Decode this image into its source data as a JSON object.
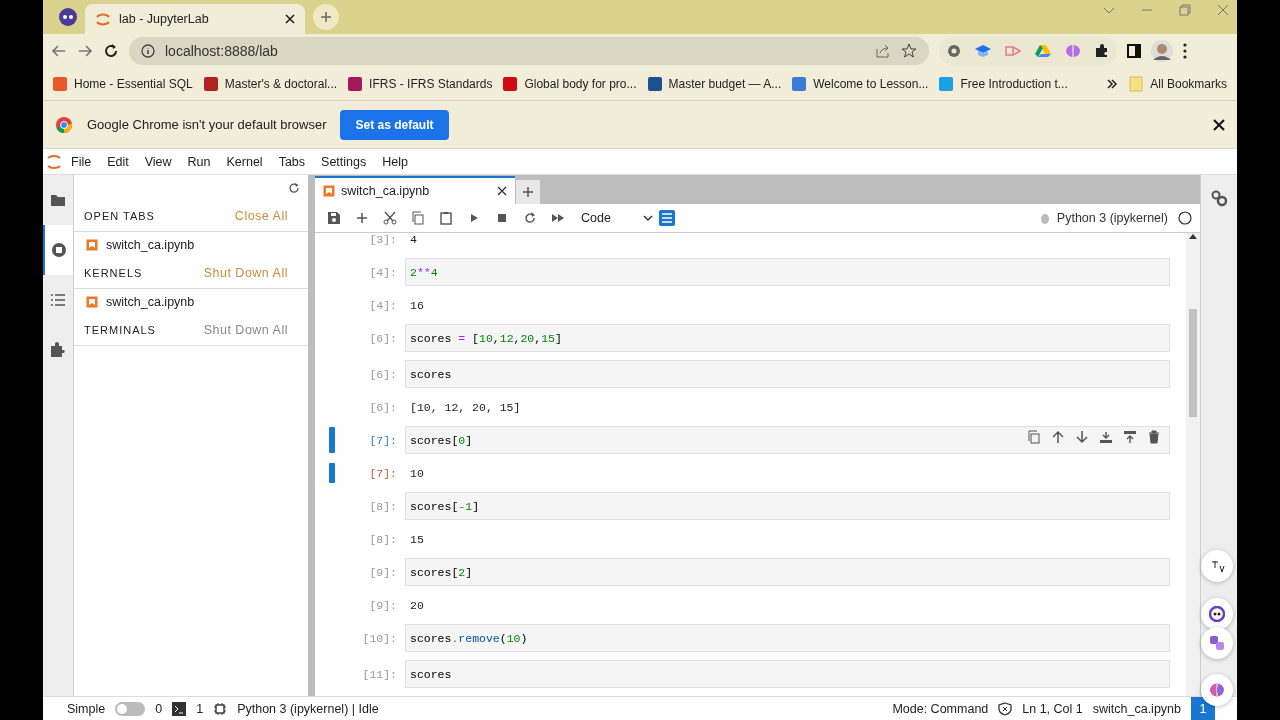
{
  "browser": {
    "tabs": [
      {
        "title": "lab - JupyterLab",
        "selected": true
      }
    ],
    "url": "localhost:8888/lab",
    "bookmarks": [
      {
        "title": "Home - Essential SQL",
        "color": "#e8582a"
      },
      {
        "title": "Master's & doctoral...",
        "color": "#b22222"
      },
      {
        "title": "IFRS - IFRS Standards",
        "color": "#a3195b"
      },
      {
        "title": "Global body for pro...",
        "color": "#d10a11"
      },
      {
        "title": "Master budget — A...",
        "color": "#1d4f91"
      },
      {
        "title": "Welcome to Lesson...",
        "color": "#3a7bd5"
      },
      {
        "title": "Free Introduction t...",
        "color": "#1ba1e2"
      }
    ],
    "all_bookmarks": "All Bookmarks"
  },
  "infobar": {
    "message": "Google Chrome isn't your default browser",
    "button": "Set as default"
  },
  "menu": [
    "File",
    "Edit",
    "View",
    "Run",
    "Kernel",
    "Tabs",
    "Settings",
    "Help"
  ],
  "sidebar": {
    "tabs": [
      {
        "kind": "folder",
        "selected": false
      },
      {
        "kind": "running",
        "selected": true
      },
      {
        "kind": "toc",
        "selected": false
      },
      {
        "kind": "extension",
        "selected": false
      }
    ],
    "sections": [
      {
        "title": "OPEN TABS",
        "action": "Close All",
        "enabled": true,
        "items": [
          "switch_ca.ipynb"
        ]
      },
      {
        "title": "KERNELS",
        "action": "Shut Down All",
        "enabled": true,
        "items": [
          "switch_ca.ipynb"
        ]
      },
      {
        "title": "TERMINALS",
        "action": "Shut Down All",
        "enabled": false
      }
    ]
  },
  "notebook": {
    "tab": {
      "title": "switch_ca.ipynb",
      "selected": true
    },
    "cell_type": "Code",
    "kernel": "Python 3 (ipykernel)",
    "cells": [
      {
        "kind": "output",
        "prompt": "[3]:",
        "text": "4",
        "selected": false
      },
      {
        "kind": "input",
        "prompt": "[4]:",
        "selected": false,
        "code": [
          {
            "kind": "num",
            "text": "2"
          },
          {
            "kind": "op",
            "text": "**"
          },
          {
            "kind": "num",
            "text": "4"
          }
        ]
      },
      {
        "kind": "output",
        "prompt": "[4]:",
        "text": "16",
        "selected": false
      },
      {
        "kind": "input",
        "prompt": "[6]:",
        "selected": false,
        "code": [
          {
            "kind": "name",
            "text": "scores "
          },
          {
            "kind": "op",
            "text": "="
          },
          {
            "kind": "name",
            "text": " ["
          },
          {
            "kind": "num",
            "text": "10"
          },
          {
            "kind": "name",
            "text": ","
          },
          {
            "kind": "num",
            "text": "12"
          },
          {
            "kind": "name",
            "text": ","
          },
          {
            "kind": "num",
            "text": "20"
          },
          {
            "kind": "name",
            "text": ","
          },
          {
            "kind": "num",
            "text": "15"
          },
          {
            "kind": "name",
            "text": "]"
          }
        ]
      },
      {
        "kind": "input",
        "prompt": "[6]:",
        "selected": false,
        "code": [
          {
            "kind": "name",
            "text": "scores"
          }
        ]
      },
      {
        "kind": "output",
        "prompt": "[6]:",
        "text": "[10, 12, 20, 15]",
        "selected": false
      },
      {
        "kind": "input",
        "prompt": "[7]:",
        "selected": true,
        "code": [
          {
            "kind": "name",
            "text": "scores["
          },
          {
            "kind": "num",
            "text": "0"
          },
          {
            "kind": "name",
            "text": "]"
          }
        ]
      },
      {
        "kind": "output",
        "prompt": "[7]:",
        "text": "10",
        "selected": true
      },
      {
        "kind": "input",
        "prompt": "[8]:",
        "selected": false,
        "code": [
          {
            "kind": "name",
            "text": "scores["
          },
          {
            "kind": "op",
            "text": "-"
          },
          {
            "kind": "num",
            "text": "1"
          },
          {
            "kind": "name",
            "text": "]"
          }
        ]
      },
      {
        "kind": "output",
        "prompt": "[8]:",
        "text": "15",
        "selected": false
      },
      {
        "kind": "input",
        "prompt": "[9]:",
        "selected": false,
        "code": [
          {
            "kind": "name",
            "text": "scores["
          },
          {
            "kind": "num",
            "text": "2"
          },
          {
            "kind": "name",
            "text": "]"
          }
        ]
      },
      {
        "kind": "output",
        "prompt": "[9]:",
        "text": "20",
        "selected": false
      },
      {
        "kind": "input",
        "prompt": "[10]:",
        "selected": false,
        "code": [
          {
            "kind": "name",
            "text": "scores"
          },
          {
            "kind": "op",
            "text": "."
          },
          {
            "kind": "attr",
            "text": "remove"
          },
          {
            "kind": "name",
            "text": "("
          },
          {
            "kind": "num",
            "text": "10"
          },
          {
            "kind": "name",
            "text": ")"
          }
        ]
      },
      {
        "kind": "input",
        "prompt": "[11]:",
        "selected": false,
        "code": [
          {
            "kind": "name",
            "text": "scores"
          }
        ]
      }
    ]
  },
  "status_bar": {
    "simple_label": "Simple",
    "simple_on": false,
    "terminals": "0",
    "kernels": "1",
    "kernel_status": "Python 3 (ipykernel) | Idle",
    "mode": "Mode: Command",
    "position": "Ln 1, Col 1",
    "file": "switch_ca.ipynb",
    "notifications": "1"
  }
}
